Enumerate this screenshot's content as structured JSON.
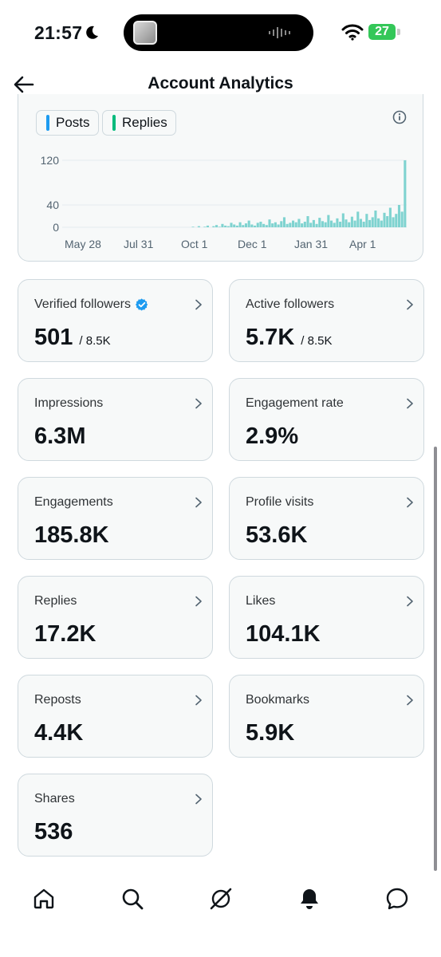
{
  "status_bar": {
    "time": "21:57",
    "battery": "27"
  },
  "header": {
    "title": "Account Analytics"
  },
  "legend": [
    {
      "label": "Posts",
      "color": "#1d9bf0"
    },
    {
      "label": "Replies",
      "color": "#00ba7c"
    }
  ],
  "chart_data": {
    "type": "bar",
    "y_ticks": [
      "120",
      "40",
      "0"
    ],
    "ylim": [
      0,
      120
    ],
    "x_ticks": [
      "May 28",
      "Jul 31",
      "Oct 1",
      "Dec 1",
      "Jan 31",
      "Apr 1"
    ],
    "bar_color": "#7fd3d0",
    "series": [
      {
        "name": "Posts",
        "color": "#1d9bf0"
      },
      {
        "name": "Replies",
        "color": "#00ba7c"
      }
    ],
    "values": [
      0,
      0,
      0,
      0,
      0,
      0,
      0,
      0,
      0,
      0,
      0,
      0,
      0,
      0,
      0,
      0,
      0,
      0,
      0,
      0,
      0,
      0,
      0,
      0,
      0,
      0,
      0,
      0,
      0,
      0,
      0,
      0,
      0,
      0,
      0,
      0,
      0,
      0,
      0,
      0,
      0,
      0,
      0,
      0,
      1,
      0,
      2,
      0,
      1,
      3,
      0,
      2,
      4,
      1,
      6,
      3,
      2,
      8,
      5,
      3,
      9,
      4,
      7,
      12,
      5,
      3,
      8,
      10,
      6,
      4,
      14,
      7,
      9,
      5,
      11,
      18,
      6,
      8,
      12,
      9,
      15,
      7,
      10,
      20,
      8,
      13,
      6,
      17,
      11,
      9,
      22,
      12,
      8,
      16,
      10,
      25,
      14,
      9,
      19,
      12,
      28,
      15,
      10,
      24,
      13,
      18,
      30,
      16,
      12,
      26,
      20,
      35,
      18,
      24,
      40,
      28,
      120
    ]
  },
  "metrics": [
    {
      "label": "Verified followers",
      "value": "501",
      "sub": "/ 8.5K",
      "verified": true
    },
    {
      "label": "Active followers",
      "value": "5.7K",
      "sub": "/ 8.5K"
    },
    {
      "label": "Impressions",
      "value": "6.3M"
    },
    {
      "label": "Engagement rate",
      "value": "2.9%"
    },
    {
      "label": "Engagements",
      "value": "185.8K"
    },
    {
      "label": "Profile visits",
      "value": "53.6K"
    },
    {
      "label": "Replies",
      "value": "17.2K"
    },
    {
      "label": "Likes",
      "value": "104.1K"
    },
    {
      "label": "Reposts",
      "value": "4.4K"
    },
    {
      "label": "Bookmarks",
      "value": "5.9K"
    },
    {
      "label": "Shares",
      "value": "536"
    }
  ],
  "nav": [
    "home-icon",
    "search-icon",
    "grok-icon",
    "notifications-icon",
    "messages-icon"
  ]
}
